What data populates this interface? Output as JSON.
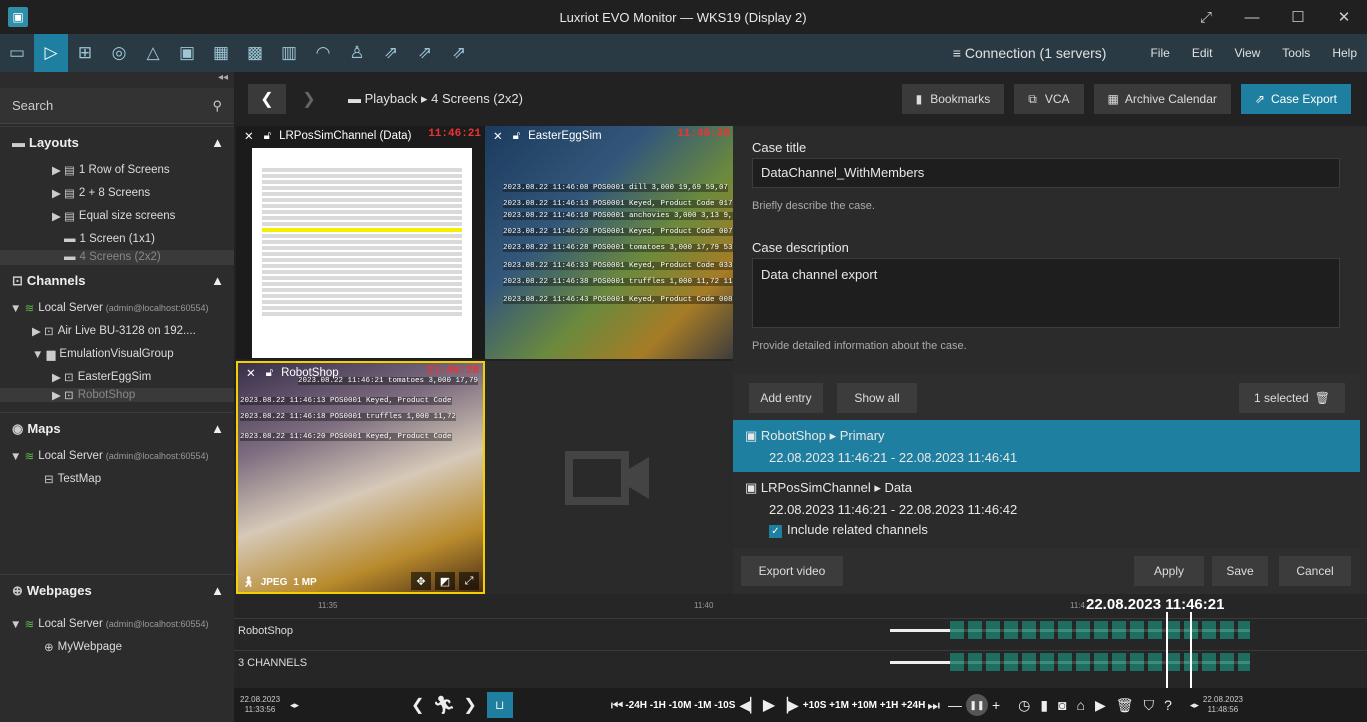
{
  "window": {
    "title": "Luxriot EVO Monitor — WKS19 (Display 2)",
    "controls": [
      "⤢",
      "—",
      "☐",
      "✕"
    ]
  },
  "toolbar": {
    "icons": [
      "monitor-icon",
      "play-icon",
      "grid-layout-icon",
      "radar-icon",
      "bell-icon",
      "camera-icon",
      "table-icon",
      "matrix-icon",
      "stats-icon",
      "helmet-icon",
      "user-search-icon",
      "export-icon",
      "export-icon-2",
      "export-icon-3"
    ],
    "connection": "Connection (1 servers)",
    "menu": [
      "File",
      "Edit",
      "View",
      "Tools",
      "Help"
    ]
  },
  "sidebar": {
    "search_placeholder": "Search",
    "layouts": {
      "title": "Layouts",
      "items": [
        "1 Row of Screens",
        "2 + 8 Screens",
        "Equal size screens",
        "1 Screen (1x1)",
        "4 Screens (2x2)"
      ]
    },
    "channels": {
      "title": "Channels",
      "server": "Local Server",
      "server_user": "(admin@localhost:60554)",
      "items": [
        "Air Live BU-3128 on 192....",
        "EmulationVisualGroup",
        "EasterEggSim",
        "RobotShop"
      ]
    },
    "maps": {
      "title": "Maps",
      "server": "Local Server",
      "server_user": "(admin@localhost:60554)",
      "items": [
        "TestMap"
      ]
    },
    "webpages": {
      "title": "Webpages",
      "server": "Local Server",
      "server_user": "(admin@localhost:60554)",
      "items": [
        "MyWebpage"
      ]
    }
  },
  "nav": {
    "mode": "Playback",
    "layout": "4 Screens (2x2)",
    "buttons": [
      "Bookmarks",
      "VCA",
      "Archive Calendar",
      "Case Export"
    ]
  },
  "cells": [
    {
      "name": "LRPosSimChannel (Data)",
      "time": "11:46:21"
    },
    {
      "name": "EasterEggSim",
      "time": "11:46:28",
      "overlay": [
        "2023.08.22 11:46:08 POS0001 dill 3,000 19,69 59,07",
        "2023.08.22 11:46:13 POS0001 Keyed, Product Code 017",
        "2023.08.22 11:46:18 POS0001 anchovies 3,000 3,13 9,",
        "2023.08.22 11:46:20 POS0001 Keyed, Product Code 007",
        "2023.08.22 11:46:28 POS0001 tomatoes 3,000 17,79 53",
        "2023.08.22 11:46:33 POS0001 Keyed, Product Code 033",
        "2023.08.22 11:46:38 POS0001 truffles 1,000 11,72 11",
        "2023.08.22 11:46:43 POS0001 Keyed, Product Code 008"
      ]
    },
    {
      "name": "RobotShop",
      "time": "11:46:28",
      "format": "JPEG",
      "resolution": "1 MP",
      "overlay": [
        "2023.08.22 11:46:21 tomatoes 3,000 17,79",
        "2023.08.22 11:46:13 POS0001 Keyed, Product Code",
        "2023.08.22 11:46:18 POS0001 truffles 1,000 11,72",
        "2023.08.22 11:46:20 POS0001 Keyed, Product Code"
      ]
    }
  ],
  "case": {
    "title_label": "Case title",
    "title_value": "DataChannel_WithMembers",
    "title_hint": "Briefly describe the case.",
    "desc_label": "Case description",
    "desc_value": "Data channel export",
    "desc_hint": "Provide detailed information about the case.",
    "add_entry": "Add entry",
    "show_all": "Show all",
    "selected": "1 selected",
    "entries": [
      {
        "channel": "RobotShop",
        "stream": "Primary",
        "range": "22.08.2023 11:46:21 - 22.08.2023 11:46:41"
      },
      {
        "channel": "LRPosSimChannel",
        "stream": "Data",
        "range": "22.08.2023 11:46:21 - 22.08.2023 11:46:42",
        "include": "Include related channels"
      }
    ],
    "export_video": "Export video",
    "apply": "Apply",
    "save": "Save",
    "cancel": "Cancel"
  },
  "timeline": {
    "ticks": [
      "11:35",
      "11:40",
      "11:4"
    ],
    "cursor": "22.08.2023 11:46:21",
    "tracks": [
      "RobotShop",
      "3 CHANNELS"
    ]
  },
  "bottom": {
    "start_date": "22.08.2023",
    "start_time": "11:33:56",
    "end_date": "22.08.2023",
    "end_time": "11:48:56",
    "steps": "-24H -1H -10M -1M -10S",
    "steps_fwd": "+10S +1M +10M +1H +24H"
  }
}
